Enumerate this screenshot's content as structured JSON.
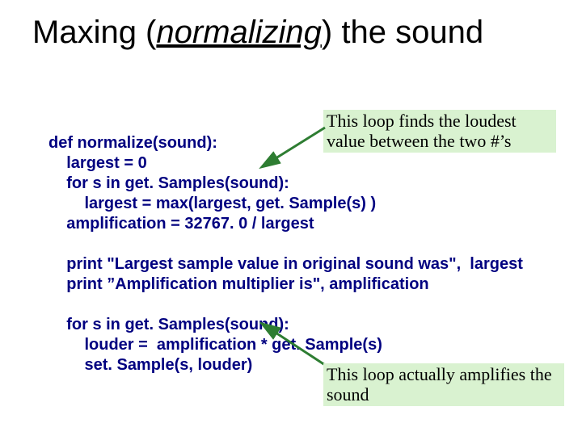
{
  "title": {
    "plain1": "Maxing (",
    "italic_underlined": "normalizing",
    "plain2": ") the sound"
  },
  "callouts": {
    "top": "This loop finds the loudest value between the two #’s",
    "bottom": "This loop actually amplifies the sound"
  },
  "code": {
    "l01": "def normalize(sound):",
    "l02": "    largest = 0",
    "l03": "    for s in get. Samples(sound):",
    "l04": "        largest = max(largest, get. Sample(s) )",
    "l05": "    amplification = 32767. 0 / largest",
    "l06": "",
    "l07": "    print \"Largest sample value in original sound was\",  largest",
    "l08": "    print ”Amplification multiplier is\", amplification",
    "l09": "",
    "l10": "    for s in get. Samples(sound):",
    "l11": "        louder =  amplification * get. Sample(s)",
    "l12": "        set. Sample(s, louder)"
  }
}
